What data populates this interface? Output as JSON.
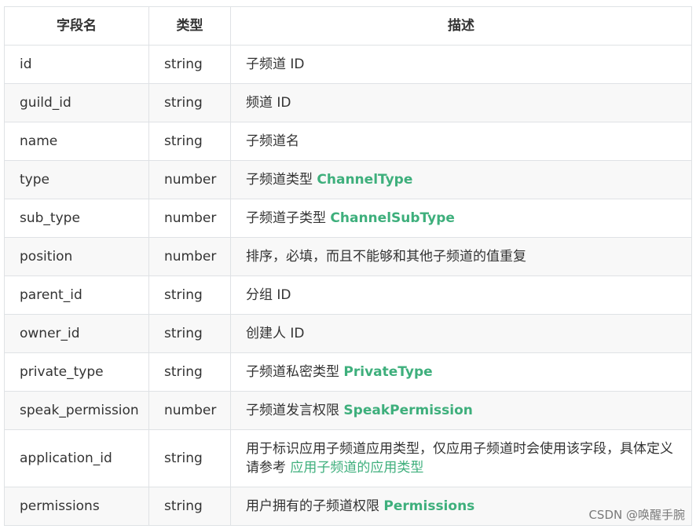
{
  "headers": {
    "field": "字段名",
    "type": "类型",
    "desc": "描述"
  },
  "rows": [
    {
      "field": "id",
      "type": "string",
      "desc": "子频道 ID",
      "link": ""
    },
    {
      "field": "guild_id",
      "type": "string",
      "desc": "频道 ID",
      "link": ""
    },
    {
      "field": "name",
      "type": "string",
      "desc": "子频道名",
      "link": ""
    },
    {
      "field": "type",
      "type": "number",
      "desc": "子频道类型 ",
      "link": "ChannelType"
    },
    {
      "field": "sub_type",
      "type": "number",
      "desc": "子频道子类型 ",
      "link": "ChannelSubType"
    },
    {
      "field": "position",
      "type": "number",
      "desc": "排序，必填，而且不能够和其他子频道的值重复",
      "link": ""
    },
    {
      "field": "parent_id",
      "type": "string",
      "desc": "分组 ID",
      "link": ""
    },
    {
      "field": "owner_id",
      "type": "string",
      "desc": "创建人 ID",
      "link": ""
    },
    {
      "field": "private_type",
      "type": "string",
      "desc": "子频道私密类型 ",
      "link": "PrivateType"
    },
    {
      "field": "speak_permission",
      "type": "number",
      "desc": "子频道发言权限 ",
      "link": "SpeakPermission"
    },
    {
      "field": "application_id",
      "type": "string",
      "desc": "用于标识应用子频道应用类型，仅应用子频道时会使用该字段，具体定义请参考 ",
      "link": "应用子频道的应用类型"
    },
    {
      "field": "permissions",
      "type": "string",
      "desc": "用户拥有的子频道权限 ",
      "link": "Permissions"
    }
  ],
  "watermark": "CSDN @唤醒手腕",
  "colors": {
    "link": "#3eaf7c",
    "border": "#dfe2e5",
    "alt_row": "#f8f8f8",
    "text": "#333333"
  }
}
